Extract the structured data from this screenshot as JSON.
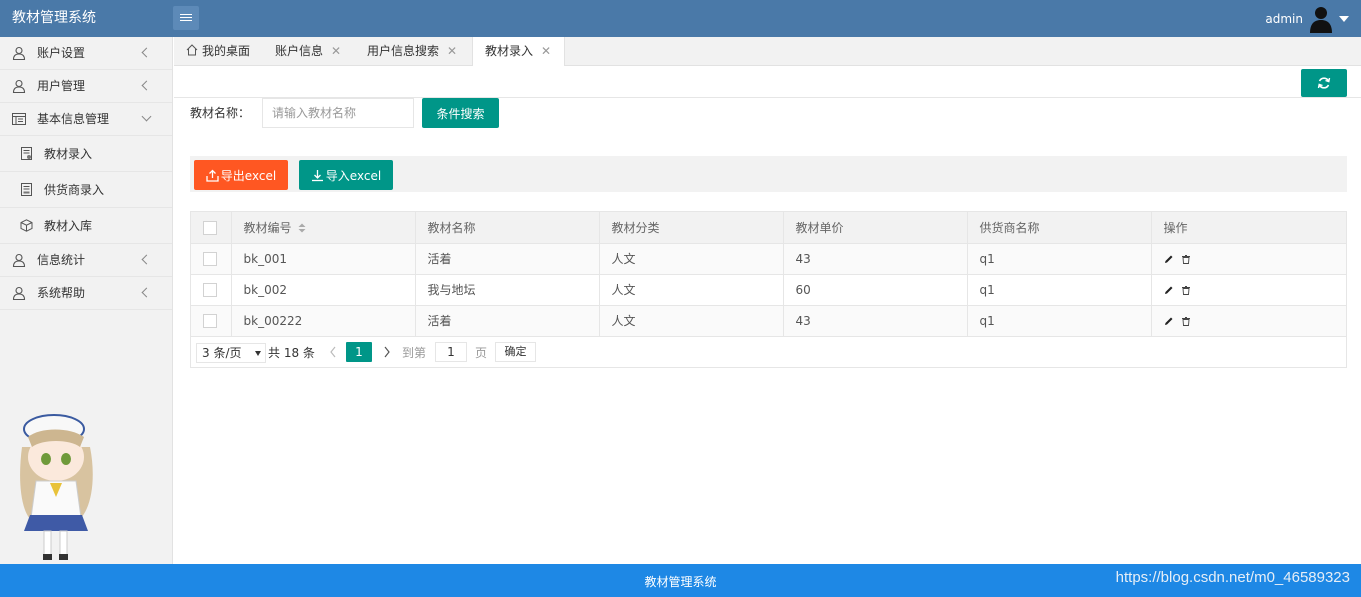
{
  "app": {
    "title": "教材管理系统",
    "user": "admin"
  },
  "sidebar": {
    "items": [
      {
        "label": "账户设置",
        "icon": "user-icon"
      },
      {
        "label": "用户管理",
        "icon": "user-icon"
      },
      {
        "label": "基本信息管理",
        "icon": "list-icon"
      },
      {
        "label": "教材录入",
        "icon": "form-icon"
      },
      {
        "label": "供货商录入",
        "icon": "form-icon"
      },
      {
        "label": "教材入库",
        "icon": "box-icon"
      },
      {
        "label": "信息统计",
        "icon": "user-icon"
      },
      {
        "label": "系统帮助",
        "icon": "user-icon"
      }
    ]
  },
  "tabs": [
    {
      "label": "我的桌面",
      "icon": "home-icon"
    },
    {
      "label": "账户信息"
    },
    {
      "label": "用户信息搜索"
    },
    {
      "label": "教材录入",
      "active": true
    }
  ],
  "search": {
    "label": "教材名称：",
    "placeholder": "请输入教材名称",
    "button": "条件搜索"
  },
  "toolbar": {
    "export_label": "导出excel",
    "import_label": "导入excel"
  },
  "table": {
    "columns": [
      "教材编号",
      "教材名称",
      "教材分类",
      "教材单价",
      "供货商名称",
      "操作"
    ],
    "rows": [
      [
        "bk_001",
        "活着",
        "人文",
        "43",
        "q1"
      ],
      [
        "bk_002",
        "我与地坛",
        "人文",
        "60",
        "q1"
      ],
      [
        "bk_00222",
        "活着",
        "人文",
        "43",
        "q1"
      ]
    ]
  },
  "pagination": {
    "page_size": "3 条/页",
    "total": "共 18 条",
    "current": "1",
    "goto_label": "到第",
    "goto_value": "1",
    "page_label": "页",
    "confirm": "确定"
  },
  "footer": {
    "title": "教材管理系统",
    "watermark": "https://blog.csdn.net/m0_46589323"
  },
  "colors": {
    "header": "#4a79a8",
    "primary": "#009688",
    "danger": "#ff5722",
    "footer": "#1e88e5"
  }
}
